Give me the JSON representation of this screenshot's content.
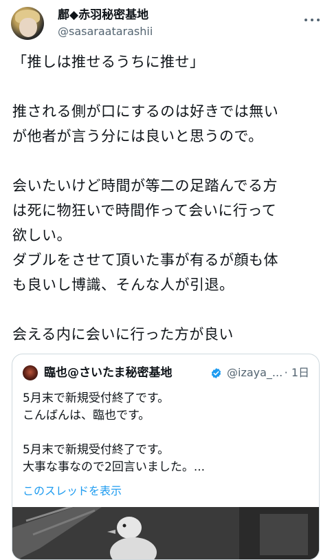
{
  "author": {
    "display_name": "鄜◆赤羽秘密基地",
    "handle": "@sasaraatarashii"
  },
  "tweet": {
    "lines": [
      "「推しは推せるうちに推せ」",
      "",
      "推される側が口にするのは好きでは無い",
      "が他者が言う分には良いと思うので。",
      "",
      "会いたいけど時間が等二の足踏んでる方",
      "は死に物狂いで時間作って会いに行って",
      "欲しい。",
      "ダブルをさせて頂いた事が有るが顔も体",
      "も良いし博識、そんな人が引退。",
      "",
      "会える内に会いに行った方が良い"
    ]
  },
  "quote": {
    "display_name": "臨也@さいたま秘密基地",
    "handle": "@izaya_...",
    "time": "· 1日",
    "lines": [
      "5月末で新規受付終了です。",
      "こんばんは、臨也です。",
      "",
      "5月末で新規受付終了です。",
      "大事な事なので2回言いました。..."
    ],
    "show_thread": "このスレッドを表示",
    "verified_color": "#1d9bf0"
  },
  "icons": {
    "more": "more-options-icon",
    "verified": "verified-badge-icon"
  }
}
